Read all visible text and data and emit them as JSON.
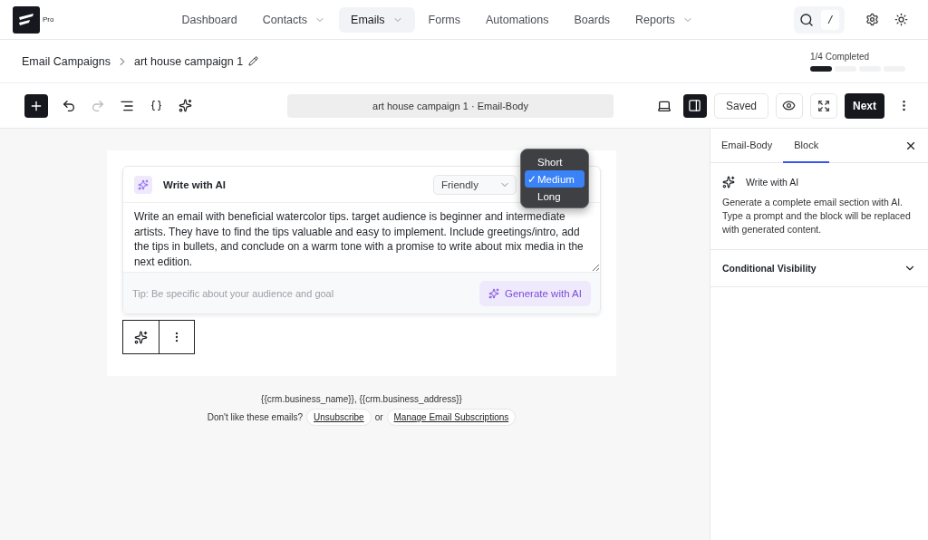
{
  "brand": {
    "badge": "Pro"
  },
  "nav": [
    {
      "label": "Dashboard",
      "selected": false,
      "dropdown": false
    },
    {
      "label": "Contacts",
      "selected": false,
      "dropdown": true
    },
    {
      "label": "Emails",
      "selected": true,
      "dropdown": true
    },
    {
      "label": "Forms",
      "selected": false,
      "dropdown": false
    },
    {
      "label": "Automations",
      "selected": false,
      "dropdown": false
    },
    {
      "label": "Boards",
      "selected": false,
      "dropdown": false
    },
    {
      "label": "Reports",
      "selected": false,
      "dropdown": true
    }
  ],
  "search": {
    "shortcut": "/"
  },
  "breadcrumb": [
    {
      "label": "Email Campaigns"
    },
    {
      "label": "art house campaign 1"
    }
  ],
  "progress": {
    "label": "1/4 Completed",
    "steps": [
      {
        "done": true
      },
      {
        "done": false
      },
      {
        "done": false
      },
      {
        "done": false
      }
    ]
  },
  "toolbar": {
    "title": "art house campaign 1 · Email-Body",
    "saved": "Saved",
    "next": "Next",
    "sidebar_open": true
  },
  "ai_block": {
    "title": "Write with AI",
    "tone": "Friendly",
    "prompt": "Write an email with beneficial watercolor tips. target audience is beginner and intermediate artists. They have to find the tips valuable and easy to implement. Include greetings/intro, add the tips in bullets, and conclude on a warm tone with a promise to write about mix media in the next edition.",
    "tip": "Tip: Be specific about your audience and goal",
    "generate": "Generate with AI",
    "length_menu": [
      {
        "label": "Short",
        "selected": false
      },
      {
        "label": "Medium",
        "selected": true
      },
      {
        "label": "Long",
        "selected": false
      }
    ],
    "check": "✓"
  },
  "footer": {
    "address": "{{crm.business_name}}, {{crm.business_address}}",
    "question": "Don't like these emails?",
    "unsubscribe": "Unsubscribe",
    "or": "or",
    "manage": "Manage Email Subscriptions"
  },
  "panel": {
    "tabs": [
      {
        "label": "Email-Body",
        "selected": false
      },
      {
        "label": "Block",
        "selected": true
      }
    ],
    "block_title": "Write with AI",
    "block_description": "Generate a complete email section with AI. Type a prompt and the block will be replaced with generated content.",
    "section": "Conditional Visibility"
  }
}
